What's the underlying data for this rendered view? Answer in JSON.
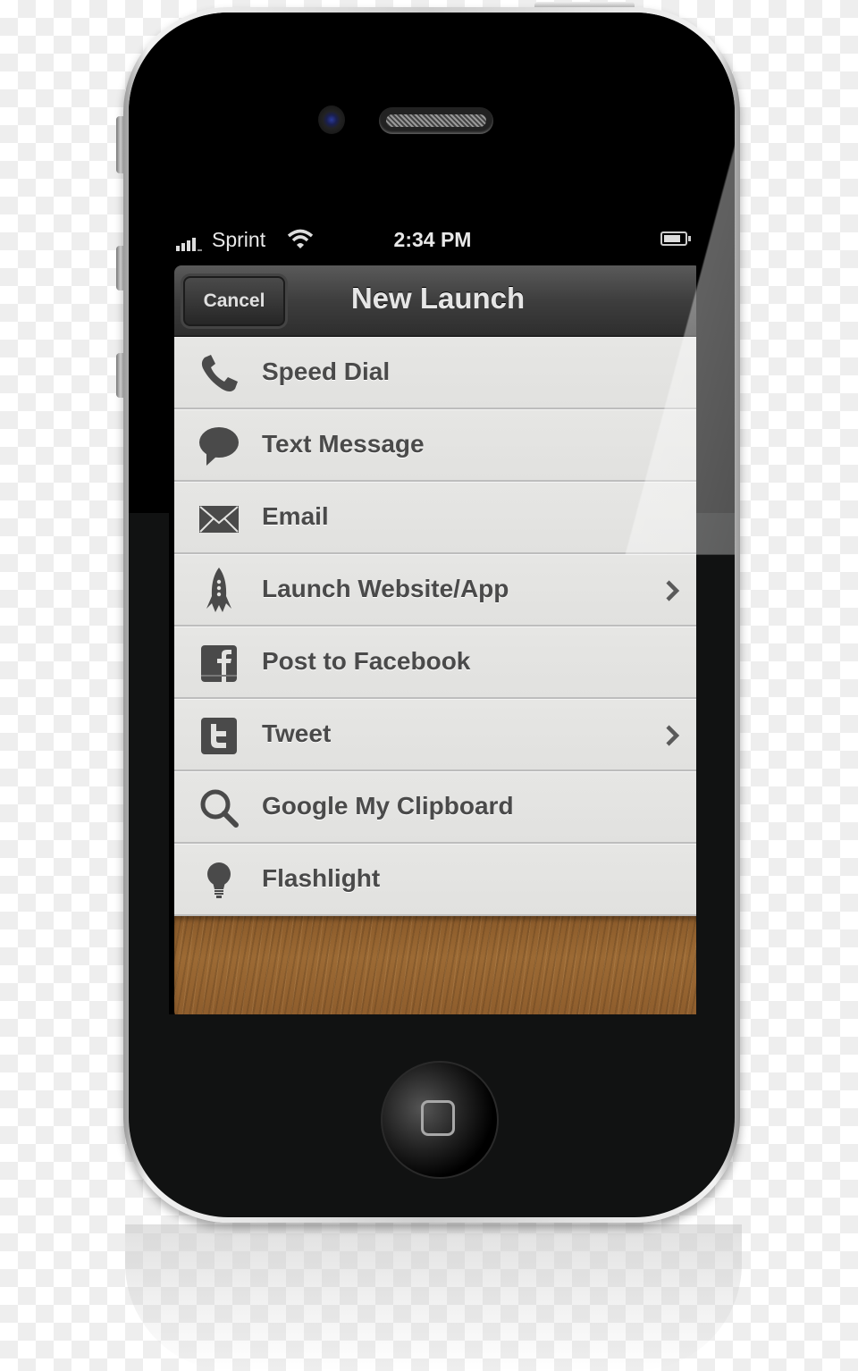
{
  "status_bar": {
    "carrier": "Sprint",
    "time": "2:34 PM",
    "signal_bars": 4,
    "wifi": true,
    "battery_level": 0.75
  },
  "nav": {
    "title": "New Launch",
    "cancel_label": "Cancel"
  },
  "colors": {
    "text": "#4a4a4a",
    "row_bg": "#e3e3e1",
    "navbar": "#3e3e3e",
    "wood": "#8d5c2c"
  },
  "menu": [
    {
      "label": "Speed Dial",
      "icon": "phone-icon",
      "chevron": false
    },
    {
      "label": "Text Message",
      "icon": "speech-bubble-icon",
      "chevron": false
    },
    {
      "label": "Email",
      "icon": "envelope-icon",
      "chevron": false
    },
    {
      "label": "Launch Website/App",
      "icon": "rocket-icon",
      "chevron": true
    },
    {
      "label": "Post to Facebook",
      "icon": "facebook-icon",
      "chevron": false
    },
    {
      "label": "Tweet",
      "icon": "twitter-icon",
      "chevron": true
    },
    {
      "label": "Google My Clipboard",
      "icon": "search-icon",
      "chevron": false
    },
    {
      "label": "Flashlight",
      "icon": "lightbulb-icon",
      "chevron": false
    }
  ]
}
